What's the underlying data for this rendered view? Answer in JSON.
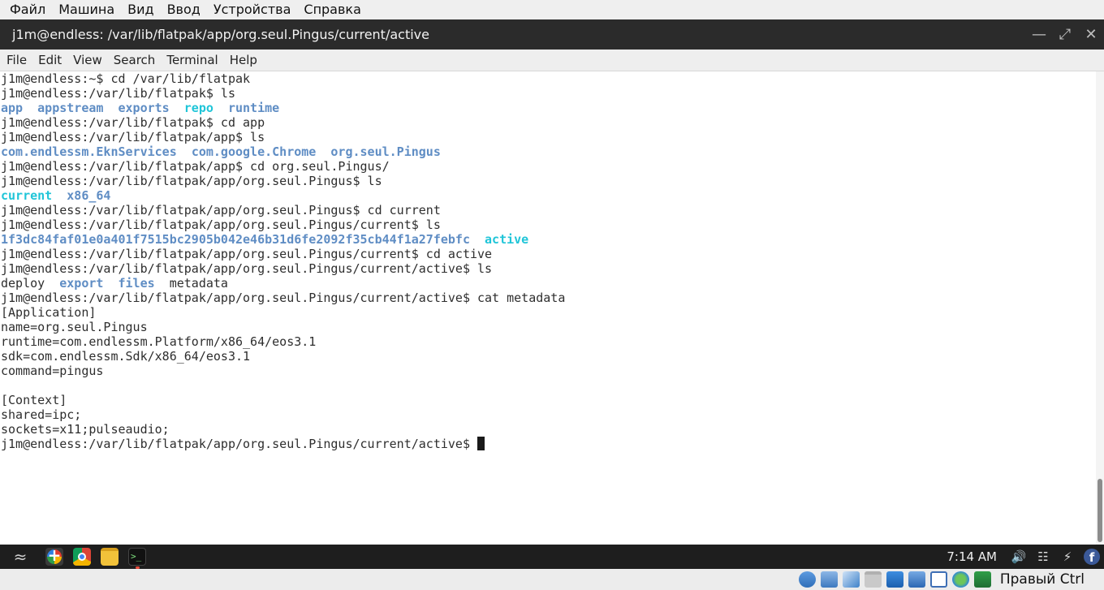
{
  "vbox_menu": [
    "Файл",
    "Машина",
    "Вид",
    "Ввод",
    "Устройства",
    "Справка"
  ],
  "window": {
    "title": "j1m@endless: /var/lib/flatpak/app/org.seul.Pingus/current/active",
    "minimize_icon": "minimize-icon",
    "maximize_icon": "maximize-icon",
    "close_icon": "close-icon"
  },
  "terminal_menu": [
    "File",
    "Edit",
    "View",
    "Search",
    "Terminal",
    "Help"
  ],
  "terminal_lines": [
    [
      {
        "text": "j1m@endless:~$ cd /var/lib/flatpak",
        "style": "plain"
      }
    ],
    [
      {
        "text": "j1m@endless:/var/lib/flatpak$ ls",
        "style": "plain"
      }
    ],
    [
      {
        "text": "app",
        "style": "dir"
      },
      {
        "text": "  ",
        "style": "plain"
      },
      {
        "text": "appstream",
        "style": "dir"
      },
      {
        "text": "  ",
        "style": "plain"
      },
      {
        "text": "exports",
        "style": "dir"
      },
      {
        "text": "  ",
        "style": "plain"
      },
      {
        "text": "repo",
        "style": "cyan"
      },
      {
        "text": "  ",
        "style": "plain"
      },
      {
        "text": "runtime",
        "style": "dir"
      }
    ],
    [
      {
        "text": "j1m@endless:/var/lib/flatpak$ cd app",
        "style": "plain"
      }
    ],
    [
      {
        "text": "j1m@endless:/var/lib/flatpak/app$ ls",
        "style": "plain"
      }
    ],
    [
      {
        "text": "com.endlessm.EknServices",
        "style": "dir"
      },
      {
        "text": "  ",
        "style": "plain"
      },
      {
        "text": "com.google.Chrome",
        "style": "dir"
      },
      {
        "text": "  ",
        "style": "plain"
      },
      {
        "text": "org.seul.Pingus",
        "style": "dir"
      }
    ],
    [
      {
        "text": "j1m@endless:/var/lib/flatpak/app$ cd org.seul.Pingus/",
        "style": "plain"
      }
    ],
    [
      {
        "text": "j1m@endless:/var/lib/flatpak/app/org.seul.Pingus$ ls",
        "style": "plain"
      }
    ],
    [
      {
        "text": "current",
        "style": "cyan"
      },
      {
        "text": "  ",
        "style": "plain"
      },
      {
        "text": "x86_64",
        "style": "dir"
      }
    ],
    [
      {
        "text": "j1m@endless:/var/lib/flatpak/app/org.seul.Pingus$ cd current",
        "style": "plain"
      }
    ],
    [
      {
        "text": "j1m@endless:/var/lib/flatpak/app/org.seul.Pingus/current$ ls",
        "style": "plain"
      }
    ],
    [
      {
        "text": "1f3dc84faf01e0a401f7515bc2905b042e46b31d6fe2092f35cb44f1a27febfc",
        "style": "dir"
      },
      {
        "text": "  ",
        "style": "plain"
      },
      {
        "text": "active",
        "style": "cyan"
      }
    ],
    [
      {
        "text": "j1m@endless:/var/lib/flatpak/app/org.seul.Pingus/current$ cd active",
        "style": "plain"
      }
    ],
    [
      {
        "text": "j1m@endless:/var/lib/flatpak/app/org.seul.Pingus/current/active$ ls",
        "style": "plain"
      }
    ],
    [
      {
        "text": "deploy",
        "style": "plain"
      },
      {
        "text": "  ",
        "style": "plain"
      },
      {
        "text": "export",
        "style": "dir"
      },
      {
        "text": "  ",
        "style": "plain"
      },
      {
        "text": "files",
        "style": "dir"
      },
      {
        "text": "  ",
        "style": "plain"
      },
      {
        "text": "metadata",
        "style": "plain"
      }
    ],
    [
      {
        "text": "j1m@endless:/var/lib/flatpak/app/org.seul.Pingus/current/active$ cat metadata",
        "style": "plain"
      }
    ],
    [
      {
        "text": "[Application]",
        "style": "plain"
      }
    ],
    [
      {
        "text": "name=org.seul.Pingus",
        "style": "plain"
      }
    ],
    [
      {
        "text": "runtime=com.endlessm.Platform/x86_64/eos3.1",
        "style": "plain"
      }
    ],
    [
      {
        "text": "sdk=com.endlessm.Sdk/x86_64/eos3.1",
        "style": "plain"
      }
    ],
    [
      {
        "text": "command=pingus",
        "style": "plain"
      }
    ],
    [
      {
        "text": "",
        "style": "plain"
      }
    ],
    [
      {
        "text": "[Context]",
        "style": "plain"
      }
    ],
    [
      {
        "text": "shared=ipc;",
        "style": "plain"
      }
    ],
    [
      {
        "text": "sockets=x11;pulseaudio;",
        "style": "plain"
      }
    ]
  ],
  "prompt": "j1m@endless:/var/lib/flatpak/app/org.seul.Pingus/current/active$ ",
  "taskbar": {
    "apps": [
      {
        "name": "app-center-icon",
        "active": false
      },
      {
        "name": "chrome-icon",
        "active": false
      },
      {
        "name": "files-icon",
        "active": false
      },
      {
        "name": "terminal-icon",
        "active": true
      }
    ],
    "clock": "7:14 AM",
    "tray": [
      "volume-icon",
      "network-icon",
      "battery-icon",
      "facebook-icon"
    ]
  },
  "statusbar": {
    "icons": [
      "hard-disk-icon",
      "optical-drive-icon",
      "usb-icon",
      "shared-folder-icon",
      "display-icon",
      "network-adapter-icon",
      "cpu-icon",
      "mouse-integration-icon",
      "capture-icon"
    ],
    "host_key": "Правый Ctrl"
  }
}
